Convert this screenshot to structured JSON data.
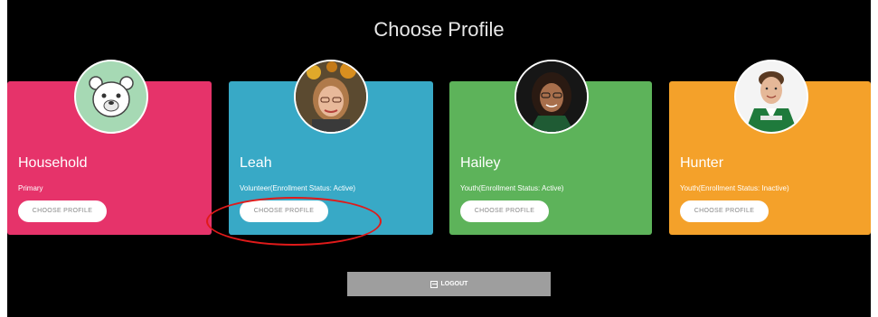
{
  "page": {
    "title": "Choose Profile"
  },
  "profiles": [
    {
      "name": "Household",
      "role": "Primary",
      "button": "CHOOSE PROFILE",
      "color": "#e6336a"
    },
    {
      "name": "Leah",
      "role": "Volunteer(Enrollment Status: Active)",
      "button": "CHOOSE PROFILE",
      "color": "#38a9c6"
    },
    {
      "name": "Hailey",
      "role": "Youth(Enrollment Status: Active)",
      "button": "CHOOSE PROFILE",
      "color": "#5db35a"
    },
    {
      "name": "Hunter",
      "role": "Youth(Enrollment Status: Inactive)",
      "button": "CHOOSE PROFILE",
      "color": "#f4a12a"
    }
  ],
  "logout": {
    "label": "LOGOUT"
  },
  "colors": {
    "background": "#000000",
    "highlight": "#e01a1a",
    "logout_button": "#9e9e9e"
  }
}
